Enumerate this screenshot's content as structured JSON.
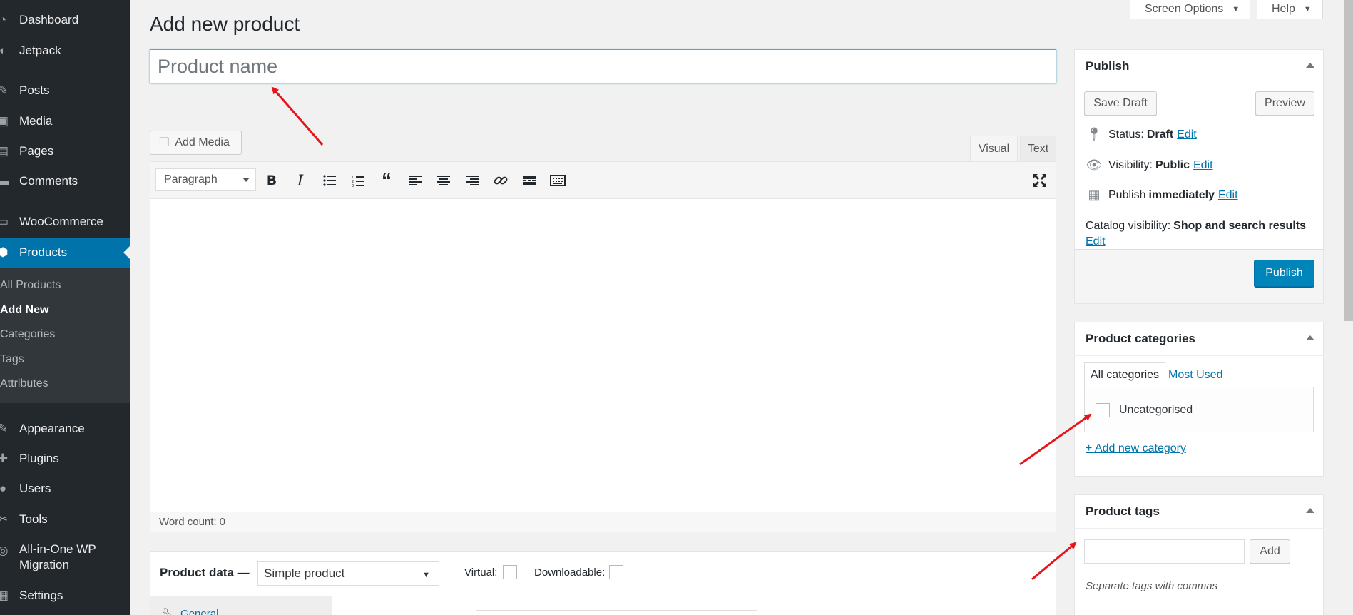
{
  "sidebar": {
    "items": [
      {
        "label": "Dashboard",
        "icon": "dashboard-icon",
        "glyph": "◔"
      },
      {
        "label": "Jetpack",
        "icon": "jetpack-icon",
        "glyph": "◐"
      },
      {
        "label": "Posts",
        "icon": "pin-icon",
        "glyph": "✎"
      },
      {
        "label": "Media",
        "icon": "media-icon",
        "glyph": "▣"
      },
      {
        "label": "Pages",
        "icon": "pages-icon",
        "glyph": "▤"
      },
      {
        "label": "Comments",
        "icon": "comments-icon",
        "glyph": "▬"
      },
      {
        "label": "WooCommerce",
        "icon": "woocommerce-icon",
        "glyph": "▭"
      },
      {
        "label": "Products",
        "icon": "products-icon",
        "glyph": "⬢"
      },
      {
        "label": "Appearance",
        "icon": "appearance-icon",
        "glyph": "✎"
      },
      {
        "label": "Plugins",
        "icon": "plugins-icon",
        "glyph": "✚"
      },
      {
        "label": "Users",
        "icon": "users-icon",
        "glyph": "●"
      },
      {
        "label": "Tools",
        "icon": "tools-icon",
        "glyph": "✂"
      },
      {
        "label": "All-in-One WP Migration",
        "icon": "migration-icon",
        "glyph": "◎"
      },
      {
        "label": "Settings",
        "icon": "settings-icon",
        "glyph": "▦"
      }
    ],
    "submenu": [
      {
        "label": "All Products"
      },
      {
        "label": "Add New"
      },
      {
        "label": "Categories"
      },
      {
        "label": "Tags"
      },
      {
        "label": "Attributes"
      }
    ]
  },
  "header": {
    "title": "Add new product",
    "screen_options": "Screen Options",
    "help": "Help"
  },
  "title_field": {
    "placeholder": "Product name",
    "value": ""
  },
  "editor": {
    "add_media": "Add Media",
    "tab_visual": "Visual",
    "tab_text": "Text",
    "format": "Paragraph",
    "word_count_label": "Word count:",
    "word_count": "0"
  },
  "product_data": {
    "title": "Product data —",
    "type": "Simple product",
    "virtual_label": "Virtual:",
    "downloadable_label": "Downloadable:",
    "general_tab": "General"
  },
  "publish": {
    "title": "Publish",
    "save_draft": "Save Draft",
    "preview": "Preview",
    "status_label": "Status:",
    "status_value": "Draft",
    "visibility_label": "Visibility:",
    "visibility_value": "Public",
    "publish_label": "Publish",
    "publish_value": "immediately",
    "catalog_label": "Catalog visibility:",
    "catalog_value": "Shop and search results",
    "edit": "Edit",
    "publish_button": "Publish"
  },
  "categories": {
    "title": "Product categories",
    "tab_all": "All categories",
    "tab_used": "Most Used",
    "items": [
      {
        "label": "Uncategorised",
        "checked": false
      }
    ],
    "add_new": "+ Add new category"
  },
  "tags": {
    "title": "Product tags",
    "add": "Add",
    "hint": "Separate tags with commas"
  },
  "colors": {
    "sidebar_bg": "#23282d",
    "accent": "#0073aa",
    "publish_button": "#0085ba",
    "annotation_arrow": "#e8141b"
  }
}
